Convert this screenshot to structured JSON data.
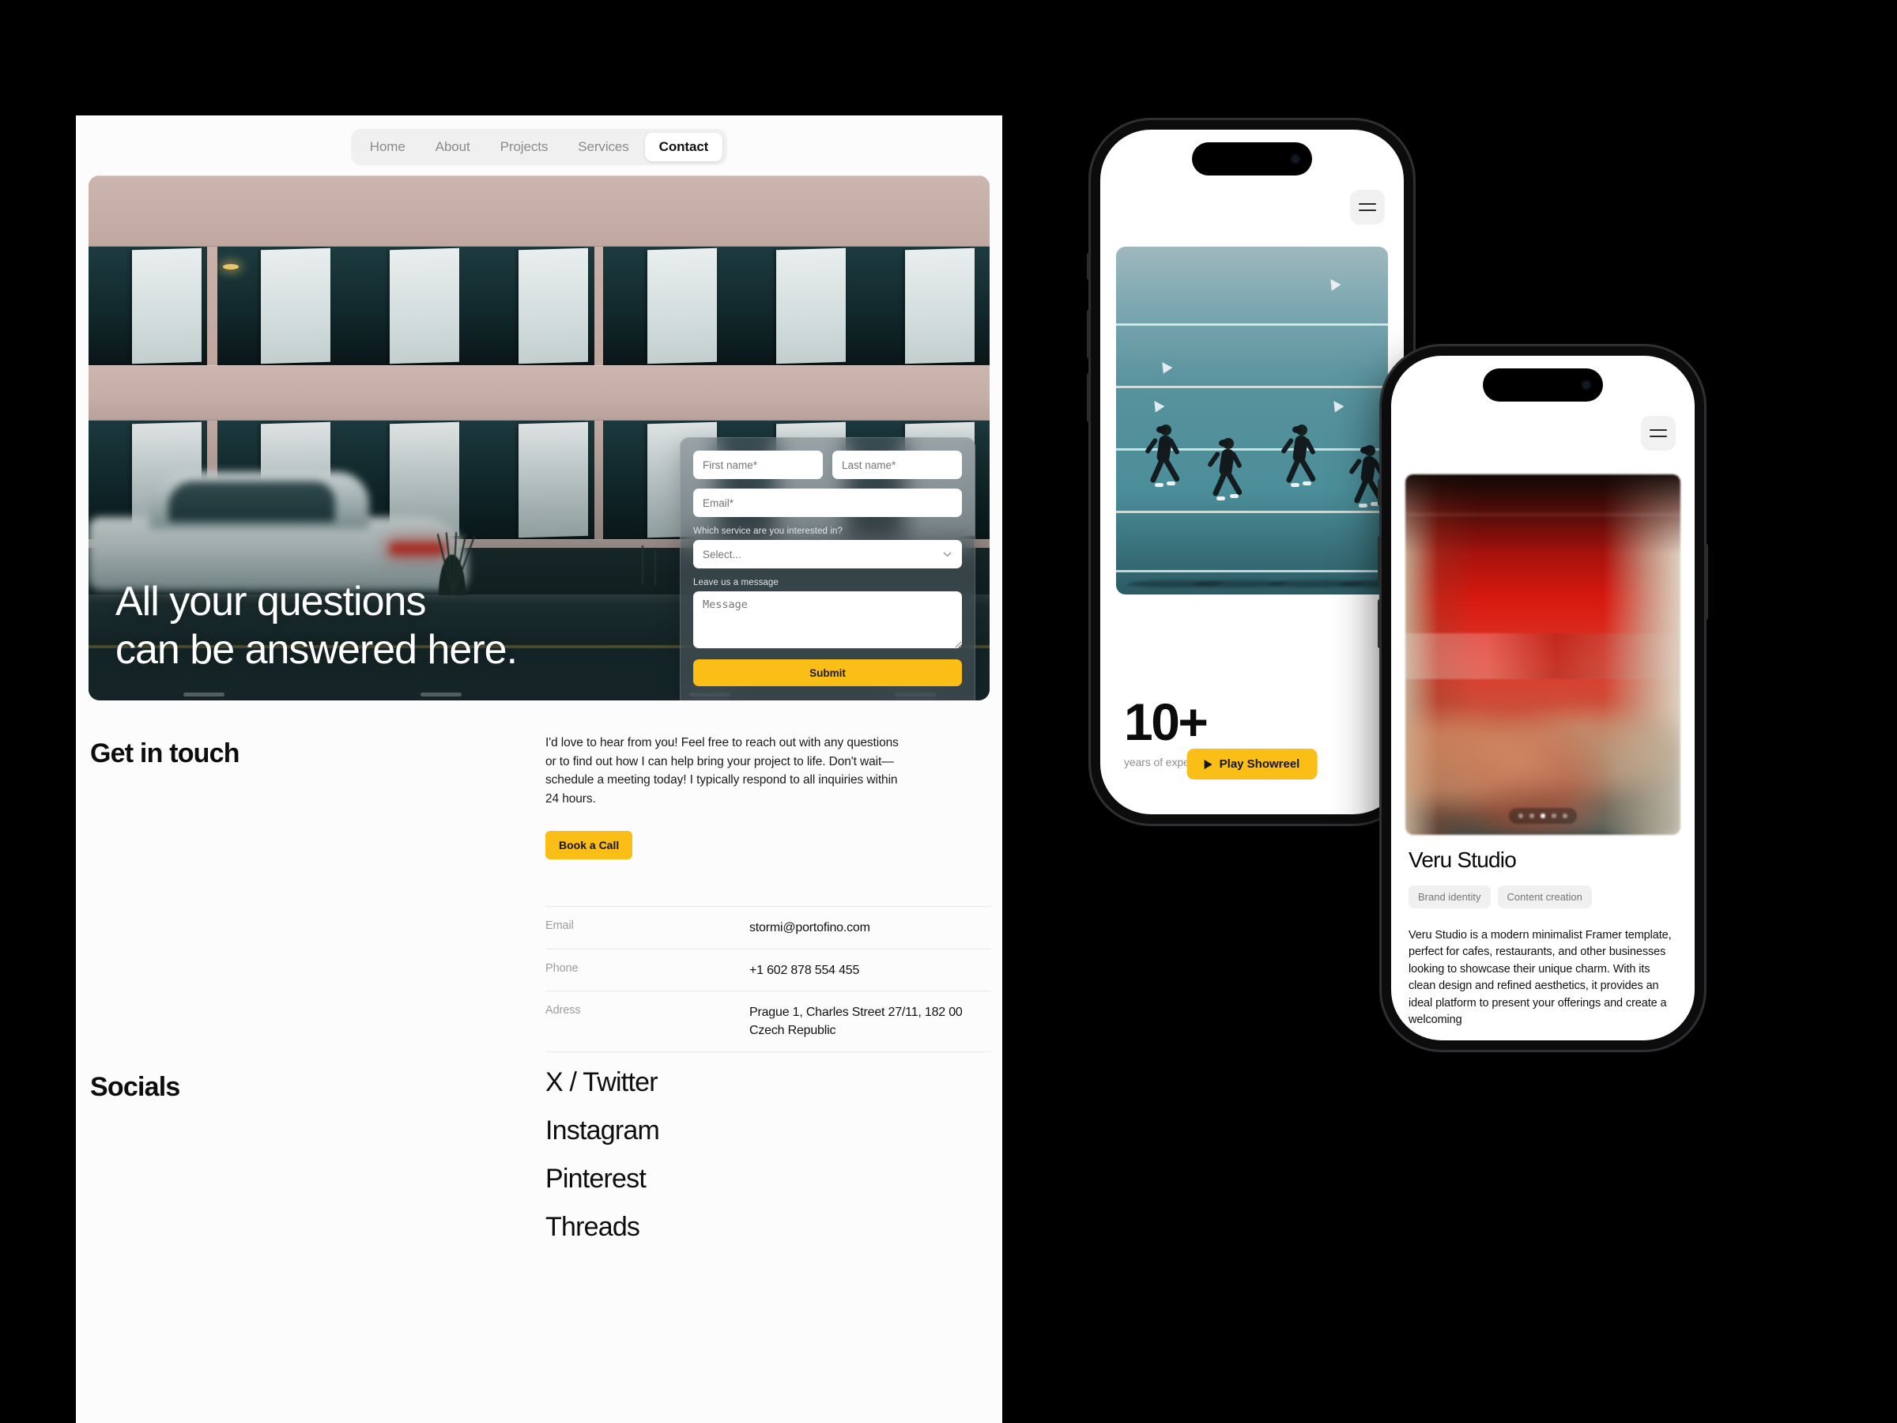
{
  "desktop": {
    "nav": {
      "items": [
        {
          "label": "Home",
          "active": false
        },
        {
          "label": "About",
          "active": false
        },
        {
          "label": "Projects",
          "active": false
        },
        {
          "label": "Services",
          "active": false
        },
        {
          "label": "Contact",
          "active": true
        }
      ]
    },
    "hero": {
      "title_line1": "All your questions",
      "title_line2": "can be answered here."
    },
    "form": {
      "first_name_placeholder": "First name*",
      "last_name_placeholder": "Last name*",
      "email_placeholder": "Email*",
      "service_label": "Which service are you interested in?",
      "service_placeholder": "Select...",
      "message_label": "Leave us a message",
      "message_placeholder": "Message",
      "submit_label": "Submit"
    },
    "get_in_touch": {
      "heading": "Get in touch",
      "paragraph": "I'd love to hear from you! Feel free to reach out with any questions or to find out how I can help bring your project to life. Don't wait—schedule a meeting today! I typically respond to all inquiries within 24 hours.",
      "cta_label": "Book a Call"
    },
    "contact_table": [
      {
        "key": "Email",
        "value": "stormi@portofino.com"
      },
      {
        "key": "Phone",
        "value": "+1 602 878 554 455"
      },
      {
        "key": "Adress",
        "value": "Prague 1, Charles Street 27/11, 182 00 Czech Republic"
      }
    ],
    "socials": {
      "heading": "Socials",
      "items": [
        "X / Twitter",
        "Instagram",
        "Pinterest",
        "Threads"
      ]
    }
  },
  "phone1": {
    "showreel_label": "Play Showreel",
    "stat_number": "10+",
    "stat_label": "years of experience"
  },
  "phone2": {
    "title": "Veru Studio",
    "tags": [
      "Brand identity",
      "Content creation"
    ],
    "description": "Veru Studio is a modern minimalist Framer template, perfect for cafes, restaurants, and other businesses looking to showcase their unique charm. With its clean design and refined aesthetics, it provides an ideal platform to present your offerings and create a welcoming",
    "carousel": {
      "count": 5,
      "active_index": 2
    }
  },
  "colors": {
    "accent": "#fbbe17",
    "background": "#000000",
    "panel": "#fcfcfc"
  }
}
